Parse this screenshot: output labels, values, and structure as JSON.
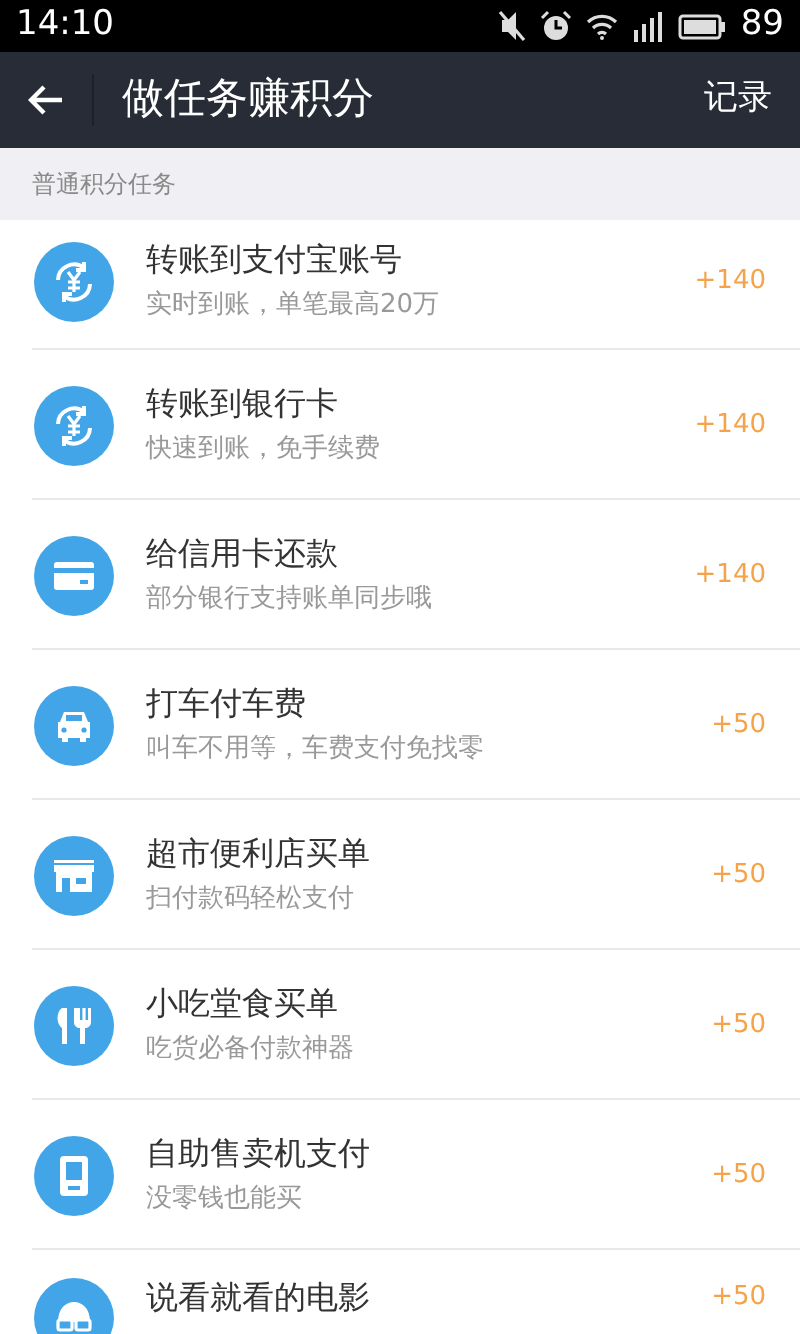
{
  "status_bar": {
    "time": "14:10",
    "battery": "89"
  },
  "header": {
    "title": "做任务赚积分",
    "action": "记录"
  },
  "section": {
    "title": "普通积分任务"
  },
  "tasks": [
    {
      "kind": "transfer",
      "title": "转账到支付宝账号",
      "subtitle": "实时到账，单笔最高20万",
      "points": "+140"
    },
    {
      "kind": "transfer",
      "title": "转账到银行卡",
      "subtitle": "快速到账，免手续费",
      "points": "+140"
    },
    {
      "kind": "card",
      "title": "给信用卡还款",
      "subtitle": "部分银行支持账单同步哦",
      "points": "+140"
    },
    {
      "kind": "taxi",
      "title": "打车付车费",
      "subtitle": "叫车不用等，车费支付免找零",
      "points": "+50"
    },
    {
      "kind": "store",
      "title": "超市便利店买单",
      "subtitle": "扫付款码轻松支付",
      "points": "+50"
    },
    {
      "kind": "food",
      "title": "小吃堂食买单",
      "subtitle": "吃货必备付款神器",
      "points": "+50"
    },
    {
      "kind": "vending",
      "title": "自助售卖机支付",
      "subtitle": "没零钱也能买",
      "points": "+50"
    },
    {
      "kind": "movie",
      "title": "说看就看的电影",
      "points": "+50"
    }
  ]
}
